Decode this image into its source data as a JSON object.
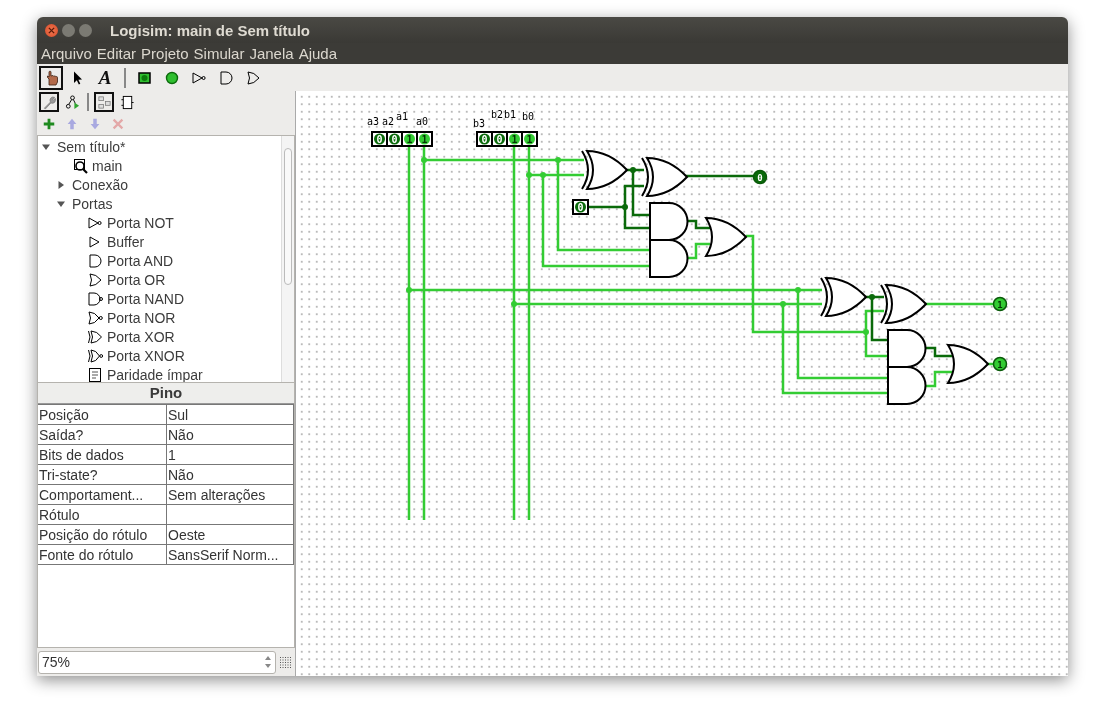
{
  "window": {
    "title": "Logisim: main de Sem título"
  },
  "menu": [
    "Arquivo",
    "Editar",
    "Projeto",
    "Simular",
    "Janela",
    "Ajuda"
  ],
  "toolbar": {
    "tools": [
      {
        "kind": "poke",
        "selected": true
      },
      {
        "kind": "select",
        "selected": false
      },
      {
        "kind": "text",
        "glyph": "A",
        "selected": false
      },
      {
        "kind": "input",
        "selected": false
      },
      {
        "kind": "output",
        "selected": false
      },
      {
        "kind": "not",
        "selected": false
      },
      {
        "kind": "and",
        "selected": false
      },
      {
        "kind": "or",
        "selected": false
      }
    ]
  },
  "explorer_toolbar": [
    {
      "kind": "wrench",
      "selected": true
    },
    {
      "kind": "hierarchy",
      "selected": false
    },
    {
      "kind": "layout",
      "selected": true
    },
    {
      "kind": "appearance",
      "selected": false
    }
  ],
  "project_buttons": [
    {
      "kind": "add",
      "disabled": false
    },
    {
      "kind": "up",
      "disabled": true
    },
    {
      "kind": "down",
      "disabled": true
    },
    {
      "kind": "remove",
      "disabled": true
    }
  ],
  "tree": [
    {
      "label": "Sem título*",
      "expanded": true,
      "children": [
        {
          "label": "main",
          "kind": "circuit"
        },
        {
          "label": "Conexão",
          "expanded": false
        },
        {
          "label": "Portas",
          "expanded": true,
          "children": [
            {
              "label": "Porta NOT",
              "kind": "not"
            },
            {
              "label": "Buffer",
              "kind": "buffer"
            },
            {
              "label": "Porta AND",
              "kind": "and"
            },
            {
              "label": "Porta OR",
              "kind": "or"
            },
            {
              "label": "Porta NAND",
              "kind": "nand"
            },
            {
              "label": "Porta NOR",
              "kind": "nor"
            },
            {
              "label": "Porta XOR",
              "kind": "xor"
            },
            {
              "label": "Porta XNOR",
              "kind": "xnor"
            },
            {
              "label": "Paridade ímpar",
              "kind": "parity"
            }
          ]
        }
      ]
    }
  ],
  "attributes": {
    "title": "Pino",
    "rows": [
      {
        "name": "Posição",
        "value": "Sul"
      },
      {
        "name": "Saída?",
        "value": "Não"
      },
      {
        "name": "Bits de dados",
        "value": "1"
      },
      {
        "name": "Tri-state?",
        "value": "Não"
      },
      {
        "name": "Comportament...",
        "value": "Sem alterações"
      },
      {
        "name": "Rótulo"
      },
      {
        "name": "Posição do rótulo",
        "value": "Oeste"
      },
      {
        "name": "Fonte do rótulo",
        "value": "SansSerif Norm..."
      }
    ]
  },
  "zoom": {
    "value": "75%"
  },
  "circuit": {
    "input_groups": [
      {
        "pins": [
          {
            "label": "a3",
            "value": "0",
            "on": false
          },
          {
            "label": "a2",
            "value": "0",
            "on": false
          },
          {
            "label": "a1",
            "value": "1",
            "on": true
          },
          {
            "label": "a0",
            "value": "1",
            "on": true
          }
        ]
      },
      {
        "pins": [
          {
            "label": "b3",
            "value": "0",
            "on": false
          },
          {
            "label": "b2",
            "value": "0",
            "on": false
          },
          {
            "label": "b1",
            "value": "1",
            "on": true
          },
          {
            "label": "b0",
            "value": "1",
            "on": true
          }
        ]
      }
    ],
    "carry_in": {
      "value": "0",
      "on": false
    },
    "outputs": [
      {
        "value": "0",
        "on": false
      },
      {
        "value": "1",
        "on": true
      },
      {
        "value": "1",
        "on": true
      }
    ]
  }
}
